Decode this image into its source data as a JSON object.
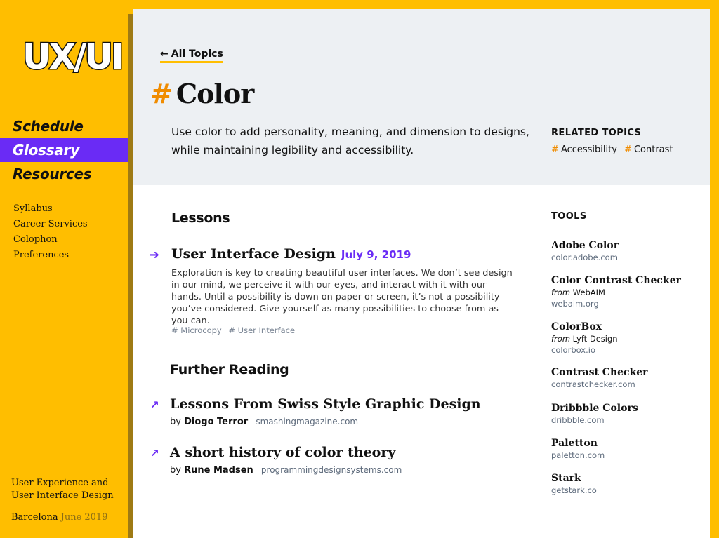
{
  "sidebar": {
    "logo": "UX/UI",
    "main_nav": [
      {
        "label": "Schedule",
        "active": false
      },
      {
        "label": "Glossary",
        "active": true
      },
      {
        "label": "Resources",
        "active": false
      }
    ],
    "sub_nav": [
      "Syllabus",
      "Career Services",
      "Colophon",
      "Preferences"
    ],
    "course_title": "User Experience and User Interface Design",
    "city": "Barcelona",
    "date": "June 2019"
  },
  "header": {
    "back_link": "All Topics",
    "back_arrow": "←",
    "hash": "#",
    "topic_title": "Color",
    "description": "Use color to add personality, meaning, and dimension to designs, while maintaining legibility and accessibility.",
    "related_label": "RELATED TOPICS",
    "related": [
      "Accessibility",
      "Contrast"
    ]
  },
  "lessons": {
    "heading": "Lessons",
    "items": [
      {
        "arrow": "➔",
        "title": "User Interface Design",
        "date": "July 9, 2019",
        "body": "Exploration is key to creating beautiful user interfaces. We don’t see design in our mind, we perceive it with our eyes, and interact with it with our hands. Until a possibility is down on paper or screen, it’s not a possibility you’ve considered. Give yourself as many possibilities to choose from as you can.",
        "tags": [
          "# Microcopy",
          "# User Interface"
        ]
      }
    ]
  },
  "further_reading": {
    "heading": "Further Reading",
    "items": [
      {
        "arrow": "↗",
        "title": "Lessons From Swiss Style Graphic Design",
        "by": "by",
        "author": "Diogo Terror",
        "site": "smashingmagazine.com"
      },
      {
        "arrow": "↗",
        "title": "A short history of color theory",
        "by": "by",
        "author": "Rune Madsen",
        "site": "programmingdesignsystems.com"
      }
    ]
  },
  "tools": {
    "label": "TOOLS",
    "items": [
      {
        "name": "Adobe Color",
        "from_word": "",
        "from": "",
        "url": "color.adobe.com"
      },
      {
        "name": "Color Contrast Checker",
        "from_word": "from",
        "from": "WebAIM",
        "url": "webaim.org"
      },
      {
        "name": "ColorBox",
        "from_word": "from",
        "from": "Lyft Design",
        "url": "colorbox.io"
      },
      {
        "name": "Contrast Checker",
        "from_word": "",
        "from": "",
        "url": "contrastchecker.com"
      },
      {
        "name": "Dribbble Colors",
        "from_word": "",
        "from": "",
        "url": "dribbble.com"
      },
      {
        "name": "Paletton",
        "from_word": "",
        "from": "",
        "url": "paletton.com"
      },
      {
        "name": "Stark",
        "from_word": "",
        "from": "",
        "url": "getstark.co"
      }
    ]
  },
  "colors": {
    "brand_yellow": "#FFBE00",
    "accent_purple": "#6A2BF5",
    "hash_orange": "#F08C00",
    "hero_gray": "#EDF0F3"
  }
}
